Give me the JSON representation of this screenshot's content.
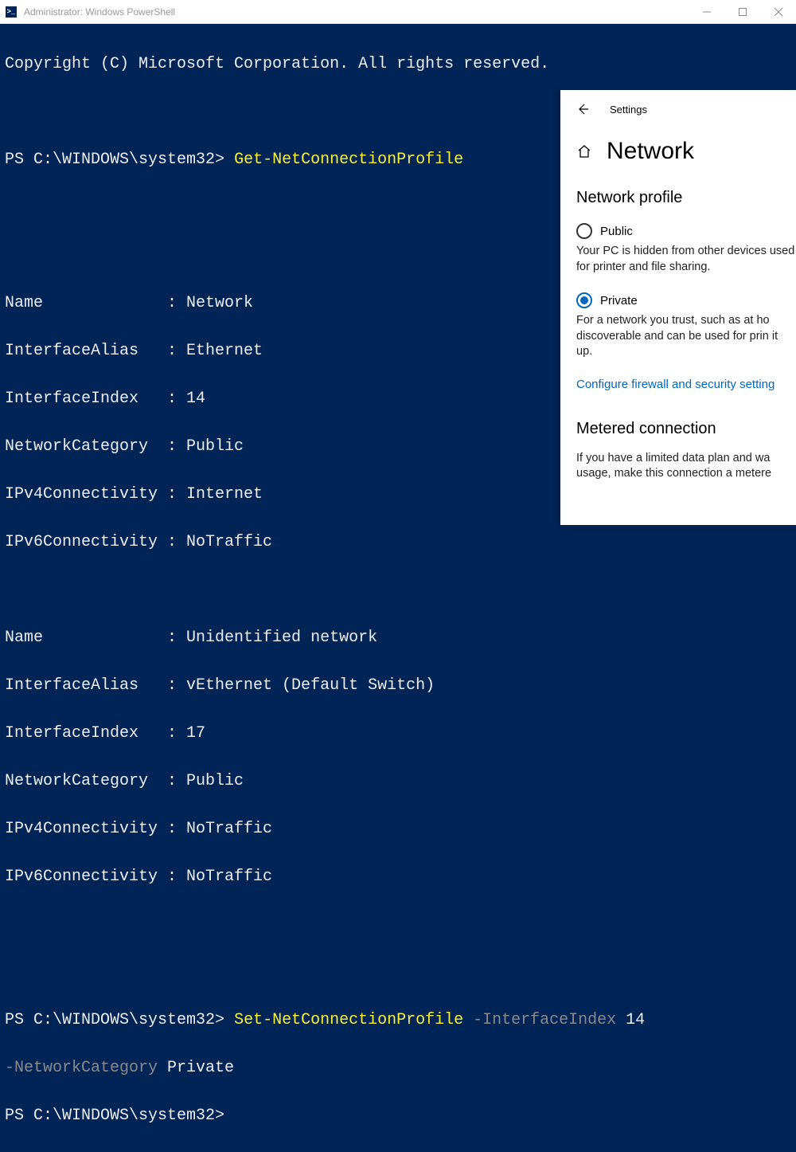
{
  "window": {
    "title": "Administrator: Windows PowerShell",
    "icon_label": ">_"
  },
  "terminal": {
    "copyright": "Copyright (C) Microsoft Corporation. All rights reserved.",
    "prompt": "PS C:\\WINDOWS\\system32>",
    "cmd1": "Get-NetConnectionProfile",
    "block1": {
      "l1": "Name             : Network",
      "l2": "InterfaceAlias   : Ethernet",
      "l3": "InterfaceIndex   : 14",
      "l4": "NetworkCategory  : Public",
      "l5": "IPv4Connectivity : Internet",
      "l6": "IPv6Connectivity : NoTraffic"
    },
    "block2": {
      "l1": "Name             : Unidentified network",
      "l2": "InterfaceAlias   : vEthernet (Default Switch)",
      "l3": "InterfaceIndex   : 17",
      "l4": "NetworkCategory  : Public",
      "l5": "IPv4Connectivity : NoTraffic",
      "l6": "IPv6Connectivity : NoTraffic"
    },
    "cmd2_yellow": "Set-NetConnectionProfile",
    "cmd2_gray": " -InterfaceIndex ",
    "cmd2_white1": "14 ",
    "cmd2_gray2": "-NetworkCategory ",
    "cmd2_white2": "Private"
  },
  "settings": {
    "header_label": "Settings",
    "page_title": "Network",
    "section1_title": "Network profile",
    "public": {
      "label": "Public",
      "desc": "Your PC is hidden from other devices used for printer and file sharing."
    },
    "private": {
      "label": "Private",
      "desc": "For a network you trust, such as at ho discoverable and can be used for prin it up."
    },
    "link_text": "Configure firewall and security setting",
    "section2_title": "Metered connection",
    "section2_desc": "If you have a limited data plan and wa usage, make this connection a metere"
  }
}
